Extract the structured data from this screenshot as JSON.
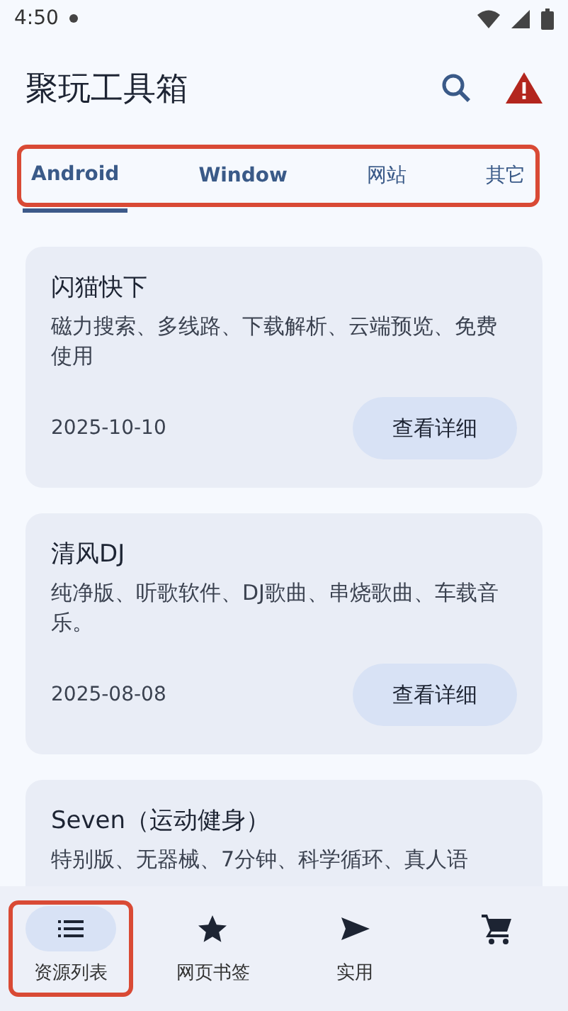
{
  "status_bar": {
    "time": "4:50"
  },
  "app_bar": {
    "title": "聚玩工具箱"
  },
  "tabs": {
    "highlighted": true,
    "items": [
      {
        "label": "Android",
        "selected": true
      },
      {
        "label": "Window",
        "selected": false
      },
      {
        "label": "网站",
        "selected": false
      },
      {
        "label": "其它",
        "selected": false
      }
    ]
  },
  "cards": [
    {
      "title": "闪猫快下",
      "description": "磁力搜索、多线路、下载解析、云端预览、免费使用",
      "date": "2025-10-10",
      "button": "查看详细"
    },
    {
      "title": "清风DJ",
      "description": "纯净版、听歌软件、DJ歌曲、串烧歌曲、车载音乐。",
      "date": "2025-08-08",
      "button": "查看详细"
    },
    {
      "title": "Seven（运动健身）",
      "description": "特别版、无器械、7分钟、科学循环、真人语"
    }
  ],
  "bottom_nav": [
    {
      "kind": "list",
      "label": "资源列表",
      "selected": true,
      "highlighted": true
    },
    {
      "kind": "star",
      "label": "网页书签",
      "selected": false,
      "highlighted": false
    },
    {
      "kind": "send",
      "label": "实用",
      "selected": false,
      "highlighted": false
    },
    {
      "kind": "cart",
      "selected": false,
      "highlighted": false
    }
  ]
}
